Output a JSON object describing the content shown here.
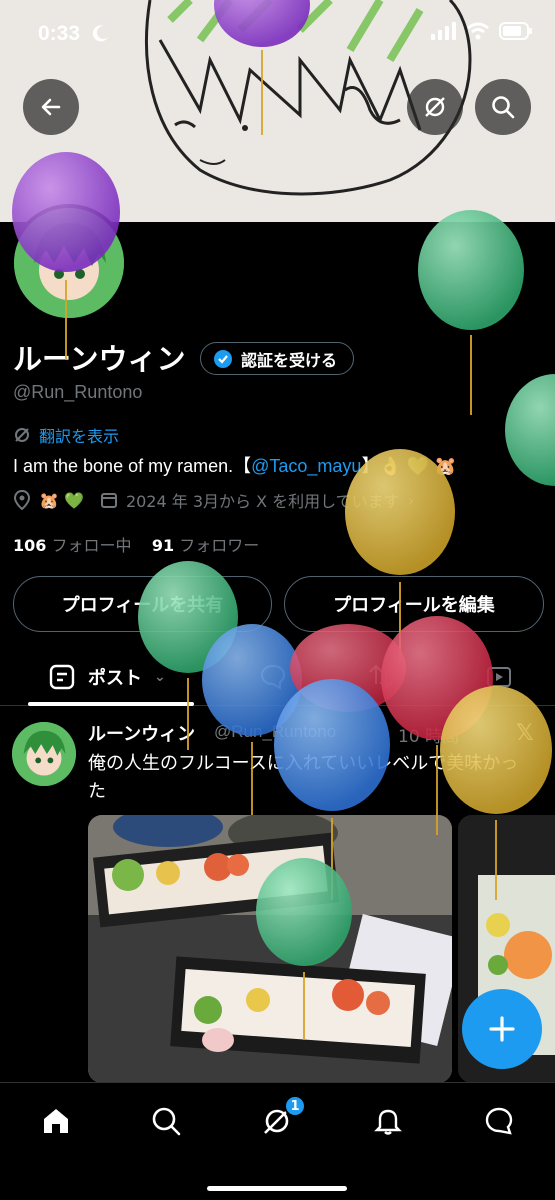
{
  "status_bar": {
    "time": "0:33"
  },
  "profile": {
    "name": "ルーンウィン",
    "verify_label": "認証を受ける",
    "handle": "@Run_Runtono",
    "translate_label": "翻訳を表示",
    "bio_prefix": "I am the bone of my ramen.【",
    "bio_mention": "@Taco_mayu",
    "bio_suffix": "】👌 💚 🐹",
    "location_emoji": "🐹 💚",
    "joined": "2024 年 3月から X を利用しています",
    "following_count": "106",
    "following_label": "フォロー中",
    "followers_count": "91",
    "followers_label": "フォロワー",
    "share_button": "プロフィールを共有",
    "edit_button": "プロフィールを編集"
  },
  "tabs": {
    "posts_label": "ポスト"
  },
  "post": {
    "name": "ルーンウィン",
    "handle": "@Run_Runtono",
    "time": "10 時間",
    "text": "俺の人生のフルコースに入れていいレベルで美味かった"
  },
  "bottom_nav": {
    "notification_badge": "1"
  },
  "colors": {
    "accent": "#1d9bf0",
    "background": "#000000",
    "muted": "#71767b"
  },
  "icons": [
    "back-arrow-icon",
    "grok-icon",
    "search-icon",
    "verified-icon",
    "translate-icon",
    "location-icon",
    "calendar-icon",
    "posts-tab-icon",
    "x-logo-icon",
    "home-icon",
    "notifications-icon",
    "messages-icon",
    "compose-icon"
  ]
}
